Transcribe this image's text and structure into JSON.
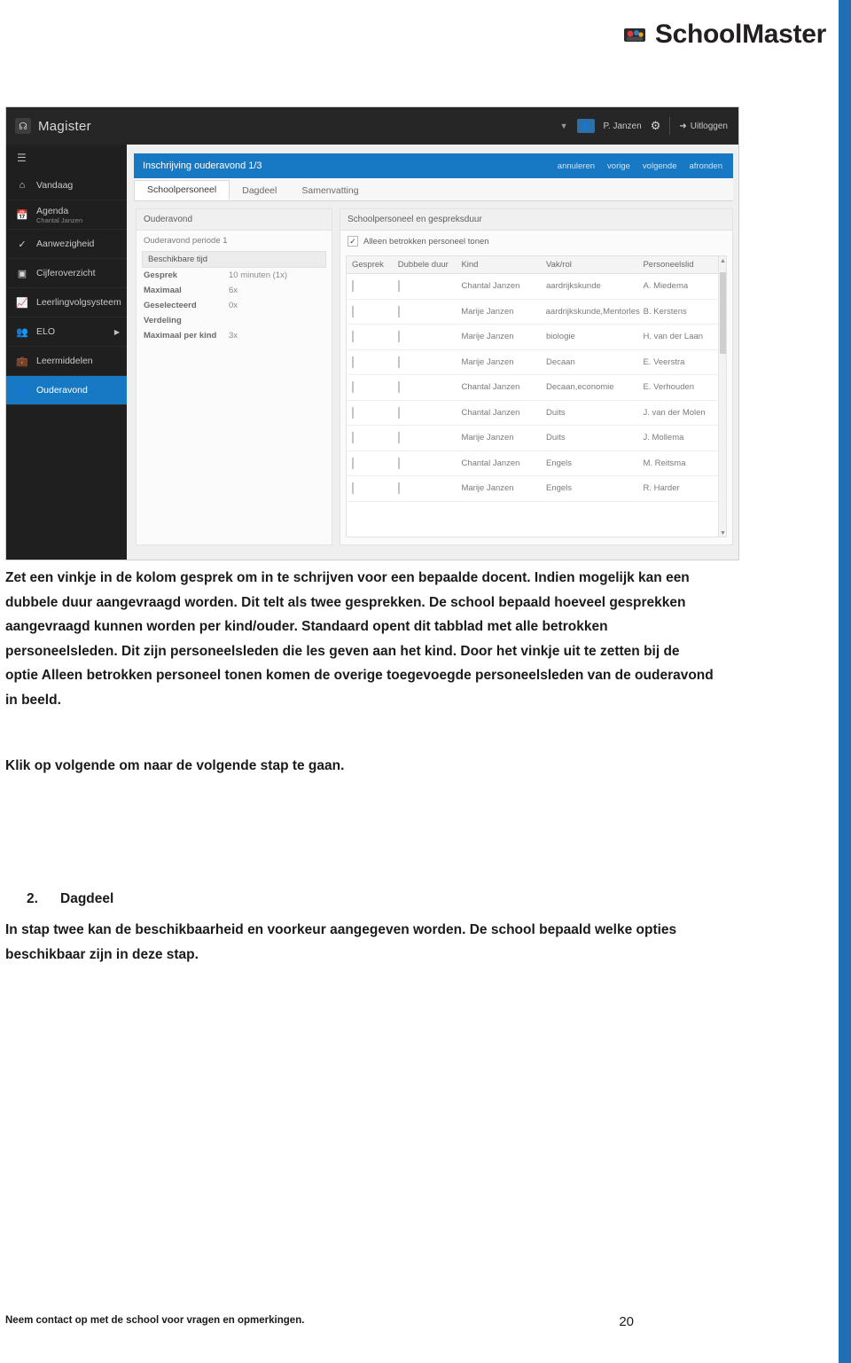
{
  "brand": {
    "name": "SchoolMaster",
    "logo_icon": "schoolmaster-logo-icon"
  },
  "screenshot": {
    "titlebar": {
      "app_icon": "magister-app-icon",
      "app_title": "Magister",
      "caret_icon": "chevron-down-icon",
      "avatar_icon": "user-avatar-icon",
      "user": "P. Janzen",
      "gear_icon": "gear-icon",
      "logout_icon": "logout-icon",
      "logout_label": "Uitloggen"
    },
    "sidebar": {
      "menu_icon": "hamburger-menu-icon",
      "items": [
        {
          "label": "Vandaag",
          "sub": "",
          "icon": "home-icon"
        },
        {
          "label": "Agenda",
          "sub": "Chantal Janzen",
          "icon": "calendar-icon"
        },
        {
          "label": "Aanwezigheid",
          "sub": "",
          "icon": "check-circle-icon"
        },
        {
          "label": "Cijferoverzicht",
          "sub": "",
          "icon": "grades-icon"
        },
        {
          "label": "Leerlingvolgsysteem",
          "sub": "",
          "icon": "chart-icon"
        },
        {
          "label": "ELO",
          "sub": "",
          "icon": "people-icon"
        },
        {
          "label": "Leermiddelen",
          "sub": "",
          "icon": "briefcase-icon"
        },
        {
          "label": "Ouderavond",
          "sub": "",
          "icon": "user-icon"
        }
      ],
      "active_item": "Ouderavond"
    },
    "blue_bar": {
      "title": "Inschrijving ouderavond 1/3",
      "actions": [
        "annuleren",
        "vorige",
        "volgende",
        "afronden"
      ]
    },
    "tabs": [
      {
        "label": "Schoolpersoneel",
        "active": true
      },
      {
        "label": "Dagdeel",
        "active": false
      },
      {
        "label": "Samenvatting",
        "active": false
      }
    ],
    "left_panel": {
      "header": "Ouderavond",
      "subtitle": "Ouderavond periode 1",
      "section_label": "Beschikbare tijd",
      "rows": [
        {
          "key": "Gesprek",
          "value": "10 minuten (1x)"
        },
        {
          "key": "Maximaal",
          "value": "6x"
        },
        {
          "key": "Geselecteerd",
          "value": "0x"
        },
        {
          "key": "Verdeling",
          "value": ""
        },
        {
          "key": "Maximaal per kind",
          "value": "3x"
        }
      ]
    },
    "right_panel": {
      "header": "Schoolpersoneel en gespreksduur",
      "filter_label": "Alleen betrokken personeel tonen",
      "filter_checked": true,
      "columns": [
        "Gesprek",
        "Dubbele duur",
        "Kind",
        "Vak/rol",
        "Personeelslid"
      ],
      "rows": [
        {
          "kind": "Chantal Janzen",
          "vak": "aardrijkskunde",
          "personeelslid": "A. Miedema"
        },
        {
          "kind": "Marije Janzen",
          "vak": "aardrijkskunde,Mentorles",
          "personeelslid": "B. Kerstens"
        },
        {
          "kind": "Marije Janzen",
          "vak": "biologie",
          "personeelslid": "H. van der Laan"
        },
        {
          "kind": "Marije Janzen",
          "vak": "Decaan",
          "personeelslid": "E. Veerstra"
        },
        {
          "kind": "Chantal Janzen",
          "vak": "Decaan,economie",
          "personeelslid": "E. Verhouden"
        },
        {
          "kind": "Chantal Janzen",
          "vak": "Duits",
          "personeelslid": "J. van der Molen"
        },
        {
          "kind": "Marije Janzen",
          "vak": "Duits",
          "personeelslid": "J. Mollema"
        },
        {
          "kind": "Chantal Janzen",
          "vak": "Engels",
          "personeelslid": "M. Reitsma"
        },
        {
          "kind": "Marije Janzen",
          "vak": "Engels",
          "personeelslid": "R. Harder"
        }
      ]
    }
  },
  "document": {
    "paragraph_1": "Zet een vinkje in de kolom gesprek om in te schrijven voor een bepaalde docent. Indien mogelijk kan een dubbele duur aangevraagd worden. Dit telt als twee gesprekken. De school bepaald hoeveel gesprekken aangevraagd kunnen worden per kind/ouder. Standaard opent dit tabblad met alle betrokken personeelsleden. Dit zijn personeelsleden die les geven aan het kind. Door het vinkje uit te zetten bij de optie Alleen betrokken personeel tonen komen de overige toegevoegde personeelsleden van de ouderavond in beeld.",
    "paragraph_2": "Klik op volgende om naar de volgende stap te gaan.",
    "section_number": "2.",
    "section_title": "Dagdeel",
    "paragraph_3": "In stap twee kan de beschikbaarheid en voorkeur aangegeven worden. De school bepaald welke opties beschikbaar zijn in deze stap.",
    "footer_note": "Neem contact op met de school voor vragen en opmerkingen.",
    "page_number": "20"
  },
  "colors": {
    "accent": "#1778c4",
    "edge_bar": "#1f6fb5",
    "dark_chrome": "#262626"
  }
}
